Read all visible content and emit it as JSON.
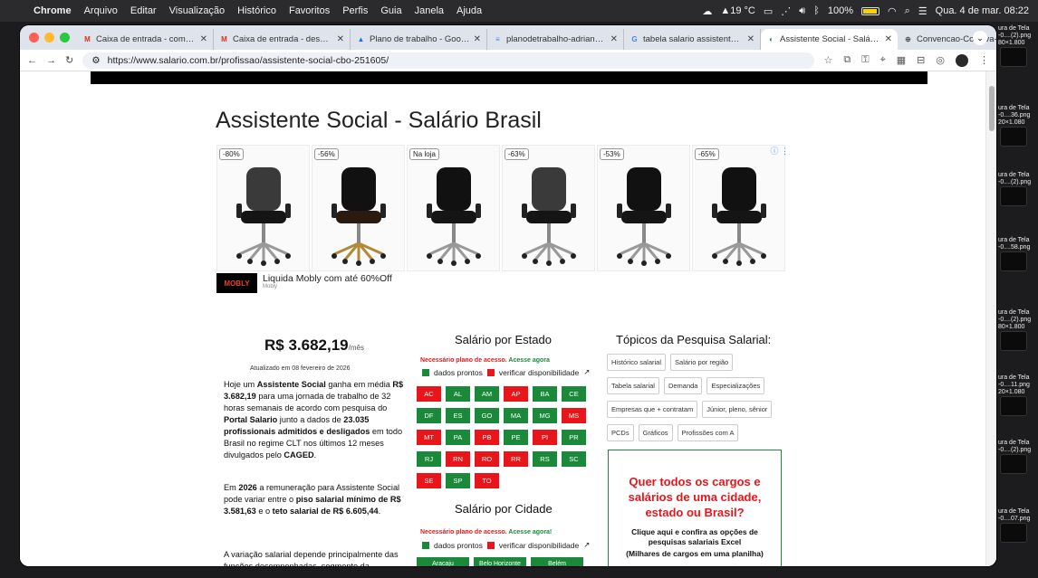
{
  "menubar": {
    "app": "Chrome",
    "items": [
      "Arquivo",
      "Editar",
      "Visualização",
      "Histórico",
      "Favoritos",
      "Perfis",
      "Guia",
      "Janela",
      "Ajuda"
    ],
    "temperature": "▲19 °C",
    "battery": "100%",
    "clock": "Qua. 4 de mar. 08:22"
  },
  "desktop": [
    {
      "label": "ura de Tela\n-0....(2).png",
      "size": "80×1.800"
    },
    {
      "label": "ura de Tela\n-0....36.png",
      "size": "20×1.080"
    },
    {
      "label": "ura de Tela\n-0....(2).png",
      "size": ""
    },
    {
      "label": "ura de Tela\n-0....58.png",
      "size": ""
    },
    {
      "label": "ura de Tela\n-0....(2).png",
      "size": "80×1.800"
    },
    {
      "label": "ura de Tela\n-0....11.png",
      "size": "20×1.080"
    },
    {
      "label": "ura de Tela\n-0....(2).png",
      "size": ""
    },
    {
      "label": "ura de Tela\n-0....07.png",
      "size": ""
    }
  ],
  "tabs": [
    {
      "title": "Caixa de entrada - comunic",
      "icon": "gmail-icon",
      "fav": "M",
      "color": "#d93025"
    },
    {
      "title": "Caixa de entrada - desenvo",
      "icon": "gmail-icon",
      "fav": "M",
      "color": "#d93025"
    },
    {
      "title": "Plano de trabalho - Google",
      "icon": "drive-icon",
      "fav": "▲",
      "color": "#1a73e8"
    },
    {
      "title": "planodetrabalho-adrianaver",
      "icon": "docs-icon",
      "fav": "≡",
      "color": "#4285f4"
    },
    {
      "title": "tabela salario assistente soc",
      "icon": "google-icon",
      "fav": "G",
      "color": "#4285f4"
    },
    {
      "title": "Assistente Social - Salário B",
      "icon": "salario-icon",
      "fav": "◐",
      "color": "#1a8a3a",
      "active": true
    },
    {
      "title": "Convencao-Coletiva-De-Tra",
      "icon": "globe-icon",
      "fav": "⊕",
      "color": "#555"
    }
  ],
  "toolbar": {
    "url": "https://www.salario.com.br/profissao/assistente-social-cbo-251605/"
  },
  "page": {
    "title": "Assistente Social - Salário Brasil",
    "ad": {
      "badges": [
        "-80%",
        "-56%",
        "Na loja",
        "-63%",
        "-53%",
        "-65%"
      ],
      "brand": "MOBLY",
      "text": "Liquida Mobly com até 60%Off",
      "sub": "Mobly",
      "info": "ⓘ ⋮"
    },
    "price": "R$ 3.682,19",
    "price_unit": "/mês",
    "updated": "Atualizado em 08 fevereiro de 2026",
    "paragraphs": [
      [
        "Hoje um ",
        {
          "b": "Assistente Social"
        },
        " ganha em média ",
        {
          "b": "R$ 3.682,19"
        },
        " para uma jornada de trabalho de 32 horas semanais de acordo com pesquisa do ",
        {
          "b": "Portal Salario"
        },
        " junto a dados de ",
        {
          "b": "23.035 profissionais admitidos e desligados"
        },
        " em todo Brasil no regime CLT nos últimos 12 meses divulgados pelo ",
        {
          "b": "CAGED"
        },
        "."
      ],
      [
        "Em ",
        {
          "b": "2026"
        },
        " a remuneração para Assistente Social pode variar entre o ",
        {
          "b": "piso salarial mínimo de R$ 3.581,63"
        },
        " e o ",
        {
          "b": "teto salarial de R$ 6.605,44"
        },
        "."
      ],
      [
        "A variação salarial depende principalmente das funções desempenhadas, segmento da empresa, localidade, formação, experiência"
      ]
    ],
    "estado": {
      "heading": "Salário por Estado",
      "notice": "Necessário plano de acesso.",
      "acesse": "Acesse agora",
      "legend_ready": "dados prontos",
      "legend_check": "verificar disponibilidade",
      "states": [
        {
          "uf": "AC",
          "ok": false
        },
        {
          "uf": "AL",
          "ok": true
        },
        {
          "uf": "AM",
          "ok": true
        },
        {
          "uf": "AP",
          "ok": false
        },
        {
          "uf": "BA",
          "ok": true
        },
        {
          "uf": "CE",
          "ok": true
        },
        {
          "uf": "DF",
          "ok": true
        },
        {
          "uf": "ES",
          "ok": true
        },
        {
          "uf": "GO",
          "ok": true
        },
        {
          "uf": "MA",
          "ok": true
        },
        {
          "uf": "MG",
          "ok": true
        },
        {
          "uf": "MS",
          "ok": false
        },
        {
          "uf": "MT",
          "ok": false
        },
        {
          "uf": "PA",
          "ok": true
        },
        {
          "uf": "PB",
          "ok": false
        },
        {
          "uf": "PE",
          "ok": true
        },
        {
          "uf": "PI",
          "ok": false
        },
        {
          "uf": "PR",
          "ok": true
        },
        {
          "uf": "RJ",
          "ok": true
        },
        {
          "uf": "RN",
          "ok": false
        },
        {
          "uf": "RO",
          "ok": false
        },
        {
          "uf": "RR",
          "ok": false
        },
        {
          "uf": "RS",
          "ok": true
        },
        {
          "uf": "SC",
          "ok": true
        },
        {
          "uf": "SE",
          "ok": false
        },
        {
          "uf": "SP",
          "ok": true
        },
        {
          "uf": "TO",
          "ok": false
        }
      ]
    },
    "cidade": {
      "heading": "Salário por Cidade",
      "notice": "Necessário plano de acesso.",
      "acesse": "Acesse agora!",
      "legend_ready": "dados prontos",
      "legend_check": "verificar disponibilidade",
      "cities": [
        "Aracaju",
        "Belo Horizonte",
        "Belém"
      ]
    },
    "topicos": {
      "heading": "Tópicos da Pesquisa Salarial:",
      "items": [
        "Histórico salarial",
        "Salário por região",
        "Tabela salarial",
        "Demanda",
        "Especializações",
        "Empresas que + contratam",
        "Júnior, pleno, sênior",
        "PCDs",
        "Gráficos",
        "Profissões com A"
      ]
    },
    "promo": {
      "heading": "Quer todos os cargos e salários de uma cidade, estado ou Brasil?",
      "body": "Clique aqui e confira as opções de pesquisas salariais Excel",
      "cut": "(Milhares de cargos em uma planilha)"
    }
  }
}
